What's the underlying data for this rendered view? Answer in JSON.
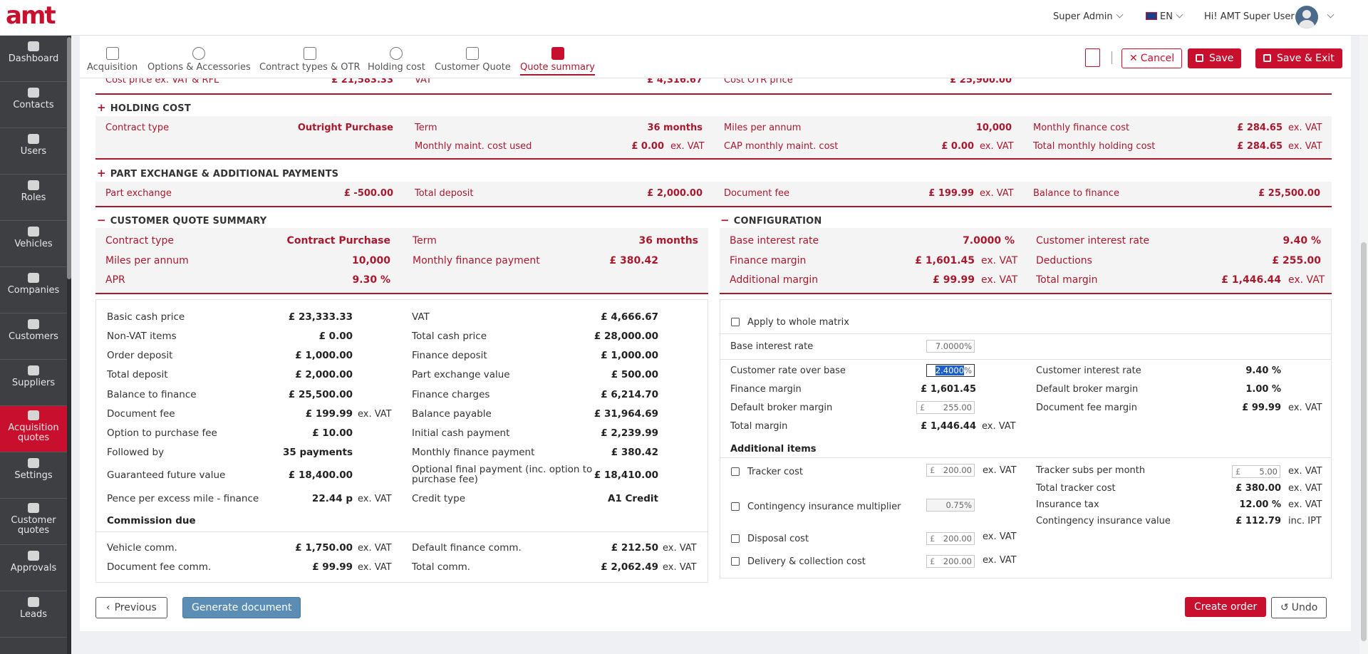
{
  "header": {
    "logo": "amt",
    "role": "Super Admin",
    "language": "EN",
    "greeting": "Hi! AMT Super User"
  },
  "sidebar": {
    "items": [
      {
        "label": "Dashboard",
        "icon": "dashboard-icon"
      },
      {
        "label": "Contacts",
        "icon": "contacts-icon"
      },
      {
        "label": "Users",
        "icon": "user-icon"
      },
      {
        "label": "Roles",
        "icon": "roles-icon"
      },
      {
        "label": "Vehicles",
        "icon": "car-icon"
      },
      {
        "label": "Companies",
        "icon": "companies-icon"
      },
      {
        "label": "Customers",
        "icon": "customers-icon"
      },
      {
        "label": "Suppliers",
        "icon": "suppliers-icon"
      },
      {
        "label": "Acquisition quotes",
        "icon": "acquisition-icon"
      },
      {
        "label": "Settings",
        "icon": "gear-icon"
      },
      {
        "label": "Customer quotes",
        "icon": "customer-quotes-icon"
      },
      {
        "label": "Approvals",
        "icon": "approvals-icon"
      },
      {
        "label": "Leads",
        "icon": "headset-icon"
      }
    ]
  },
  "tabs": [
    "Acquisition",
    "Options & Accessories",
    "Contract types & OTR",
    "Holding cost",
    "Customer Quote",
    "Quote summary"
  ],
  "actions": {
    "cancel": "Cancel",
    "save": "Save",
    "save_exit": "Save & Exit"
  },
  "top_row": {
    "cost_price_label": "Cost price ex. VAT & RFL",
    "cost_price": "£ 21,583.33",
    "vat_label": "VAT",
    "vat": "£ 4,316.67",
    "cost_otr_label": "Cost OTR price",
    "cost_otr": "£ 25,900.00"
  },
  "holding": {
    "title": "HOLDING COST",
    "contract_type_label": "Contract type",
    "contract_type": "Outright Purchase",
    "term_label": "Term",
    "term": "36 months",
    "miles_label": "Miles per annum",
    "miles": "10,000",
    "monthly_finance_label": "Monthly finance cost",
    "monthly_finance": "£ 284.65",
    "maint_used_label": "Monthly maint. cost used",
    "maint_used": "£ 0.00",
    "cap_maint_label": "CAP monthly maint. cost",
    "cap_maint": "£ 0.00",
    "total_holding_label": "Total monthly holding cost",
    "total_holding": "£ 284.65",
    "exvat": "ex. VAT"
  },
  "partex": {
    "title": "PART EXCHANGE & ADDITIONAL PAYMENTS",
    "part_exchange_label": "Part exchange",
    "part_exchange": "£ -500.00",
    "total_deposit_label": "Total deposit",
    "total_deposit": "£ 2,000.00",
    "doc_fee_label": "Document fee",
    "doc_fee": "£ 199.99",
    "balance_label": "Balance to finance",
    "balance": "£ 25,500.00"
  },
  "cqs": {
    "title": "CUSTOMER QUOTE SUMMARY",
    "contract_type_label": "Contract type",
    "contract_type": "Contract Purchase",
    "term_label": "Term",
    "term": "36 months",
    "miles_label": "Miles per annum",
    "miles": "10,000",
    "mfp_label": "Monthly finance payment",
    "mfp": "£ 380.42",
    "apr_label": "APR",
    "apr": "9.30 %"
  },
  "config": {
    "title": "CONFIGURATION",
    "base_rate_label": "Base interest rate",
    "base_rate": "7.0000 %",
    "cust_rate_label": "Customer interest rate",
    "cust_rate": "9.40 %",
    "fin_margin_label": "Finance margin",
    "fin_margin": "£ 1,601.45",
    "deductions_label": "Deductions",
    "deductions": "£ 255.00",
    "add_margin_label": "Additional margin",
    "add_margin": "£ 99.99",
    "total_margin_label": "Total margin",
    "total_margin": "£ 1,446.44"
  },
  "details": {
    "left": [
      {
        "label": "Basic cash price",
        "value": "£ 23,333.33",
        "unit": ""
      },
      {
        "label": "Non-VAT items",
        "value": "£ 0.00",
        "unit": ""
      },
      {
        "label": "Order deposit",
        "value": "£ 1,000.00",
        "unit": ""
      },
      {
        "label": "Total deposit",
        "value": "£ 2,000.00",
        "unit": ""
      },
      {
        "label": "Balance to finance",
        "value": "£ 25,500.00",
        "unit": ""
      },
      {
        "label": "Document fee",
        "value": "£ 199.99",
        "unit": "ex. VAT"
      },
      {
        "label": "Option to purchase fee",
        "value": "£ 10.00",
        "unit": ""
      },
      {
        "label": "Followed by",
        "value": "35 payments",
        "unit": ""
      },
      {
        "label": "Guaranteed future value",
        "value": "£ 18,400.00",
        "unit": ""
      },
      {
        "label": "Pence per excess mile - finance",
        "value": "22.44 p",
        "unit": "ex. VAT"
      }
    ],
    "right": [
      {
        "label": "VAT",
        "value": "£ 4,666.67"
      },
      {
        "label": "Total cash price",
        "value": "£ 28,000.00"
      },
      {
        "label": "Finance deposit",
        "value": "£ 1,000.00"
      },
      {
        "label": "Part exchange value",
        "value": "£ 500.00"
      },
      {
        "label": "Finance charges",
        "value": "£ 6,214.70"
      },
      {
        "label": "Balance payable",
        "value": "£ 31,964.69"
      },
      {
        "label": "Initial cash payment",
        "value": "£ 2,239.99"
      },
      {
        "label": "Monthly finance payment",
        "value": "£ 380.42"
      },
      {
        "label": "Optional final payment (inc. option to purchase fee)",
        "value": "£ 18,410.00"
      },
      {
        "label": "Credit type",
        "value": "A1 Credit"
      }
    ],
    "commission_title": "Commission due",
    "vehicle_comm_label": "Vehicle comm.",
    "vehicle_comm": "£ 1,750.00",
    "default_fin_comm_label": "Default finance comm.",
    "default_fin_comm": "£ 212.50",
    "doc_fee_comm_label": "Document fee comm.",
    "doc_fee_comm": "£ 99.99",
    "total_comm_label": "Total comm.",
    "total_comm": "£ 2,062.49",
    "exvat": "ex. VAT"
  },
  "cfg_panel": {
    "apply_label": "Apply to whole matrix",
    "base_rate_label": "Base interest rate",
    "base_rate": "7.0000",
    "cust_over_base_label": "Customer rate over base",
    "cust_over_base": "2.4000",
    "cust_rate_label": "Customer interest rate",
    "cust_rate": "9.40 %",
    "fin_margin_label": "Finance margin",
    "fin_margin": "£ 1,601.45",
    "def_broker_label": "Default broker margin",
    "def_broker_pct": "1.00 %",
    "def_broker_value": "255.00",
    "doc_fee_margin_label": "Document fee margin",
    "doc_fee_margin": "£ 99.99",
    "total_margin_label": "Total margin",
    "total_margin": "£ 1,446.44",
    "additional_title": "Additional items",
    "tracker_label": "Tracker cost",
    "tracker": "200.00",
    "tracker_subs_label": "Tracker subs per month",
    "tracker_subs": "5.00",
    "total_tracker_label": "Total tracker cost",
    "total_tracker": "£ 380.00",
    "contingency_label": "Contingency insurance multiplier",
    "contingency": "0.75",
    "ins_tax_label": "Insurance tax",
    "ins_tax": "12.00 %",
    "cont_value_label": "Contingency insurance value",
    "cont_value": "£ 112.79",
    "inc_ipt": "inc. IPT",
    "disposal_label": "Disposal cost",
    "disposal": "200.00",
    "delivery_label": "Delivery & collection cost",
    "delivery": "200.00",
    "pct": "%",
    "gbp": "£",
    "exvat": "ex. VAT"
  },
  "footer": {
    "previous": "Previous",
    "generate": "Generate document",
    "create_order": "Create order",
    "undo": "Undo"
  }
}
